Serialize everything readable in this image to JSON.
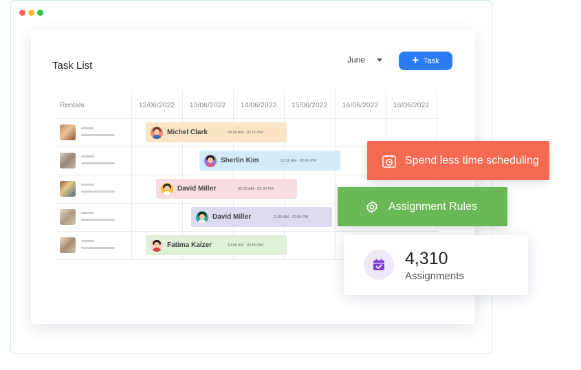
{
  "window": {
    "dot_colors": [
      "#fb6159",
      "#fcbc2e",
      "#28c840"
    ]
  },
  "task_list": {
    "title": "Task List",
    "month_select": {
      "value": "June"
    },
    "add_task_button": {
      "label": "Task",
      "icon": "plus-icon",
      "color": "#2b7cf2"
    },
    "columns": {
      "first": "Rentals",
      "dates": [
        "12/06/2022",
        "13/06/2022",
        "14/06/2022",
        "15/06/2022",
        "16/06/2022",
        "16/06/2022"
      ]
    },
    "rows": [
      {
        "thumbnail": "rental-photo-1",
        "assignment": {
          "name": "Michel Clark",
          "time": "09:00 AM - 02:00 PM",
          "color": "#f9e5c3"
        }
      },
      {
        "thumbnail": "rental-photo-2",
        "assignment": {
          "name": "Sherlin Kim",
          "time": "10:30 AM - 02:00 PM",
          "color": "#d2ebf7"
        }
      },
      {
        "thumbnail": "rental-photo-3",
        "assignment": {
          "name": "David Miller",
          "time": "09:30 AM - 02:00 PM",
          "color": "#f7dde2"
        }
      },
      {
        "thumbnail": "rental-photo-4",
        "assignment": {
          "name": "David Miller",
          "time": "11:30 AM - 02:00 PM",
          "color": "#dcdaef"
        }
      },
      {
        "thumbnail": "rental-photo-5",
        "assignment": {
          "name": "Fatima Kaizer",
          "time": "10:00 AM - 02:00 PM",
          "color": "#def0d6"
        }
      }
    ]
  },
  "callouts": {
    "scheduling": {
      "label": "Spend less time scheduling",
      "icon": "calendar-clock-icon",
      "color": "#f46a53"
    },
    "rules": {
      "label": "Assignment Rules",
      "icon": "gear-icon",
      "color": "#6ab856"
    }
  },
  "stats": {
    "value": "4,310",
    "label": "Assignments",
    "icon": "calendar-check-icon",
    "icon_color": "#7b3fd4"
  }
}
